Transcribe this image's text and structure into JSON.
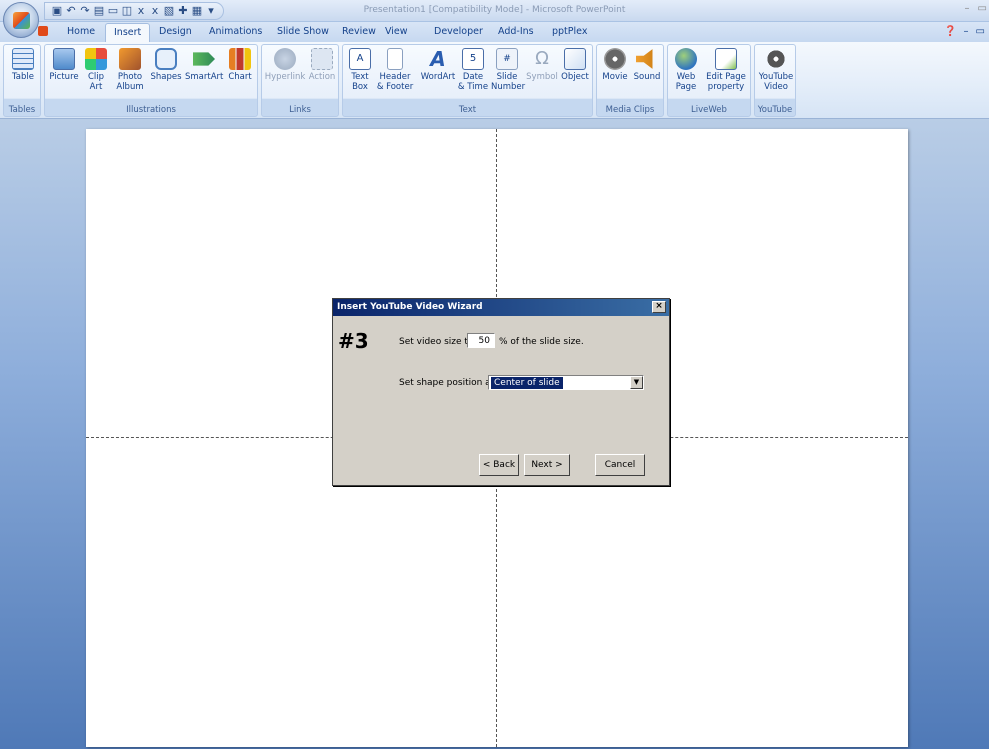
{
  "window": {
    "title": "Presentation1 [Compatibility Mode] - Microsoft PowerPoint"
  },
  "quick_access": {
    "icons": [
      "save-icon",
      "undo-icon",
      "redo-icon",
      "open-icon",
      "new-slide-icon",
      "insert-icon",
      "subscript-icon",
      "superscript-icon",
      "picture-icon",
      "clip-art-icon",
      "customize-icon"
    ]
  },
  "tabs": [
    "Home",
    "Insert",
    "Design",
    "Animations",
    "Slide Show",
    "Review",
    "View",
    "Developer",
    "Add-Ins",
    "pptPlex"
  ],
  "active_tab": "Insert",
  "ribbon": {
    "groups": {
      "tables": "Tables",
      "illustrations": "Illustrations",
      "links": "Links",
      "text": "Text",
      "media": "Media Clips",
      "liveweb": "LiveWeb",
      "youtube": "YouTube"
    },
    "buttons": {
      "table": "Table",
      "picture": "Picture",
      "clip_art": "Clip\nArt",
      "photo_album": "Photo\nAlbum",
      "shapes": "Shapes",
      "smartart": "SmartArt",
      "chart": "Chart",
      "hyperlink": "Hyperlink",
      "action": "Action",
      "text_box": "Text\nBox",
      "header_footer": "Header\n& Footer",
      "wordart": "WordArt",
      "date_time": "Date\n& Time",
      "slide_number": "Slide\nNumber",
      "symbol": "Symbol",
      "object": "Object",
      "movie": "Movie",
      "sound": "Sound",
      "web_page": "Web\nPage",
      "edit_page_property": "Edit Page\nproperty",
      "youtube_video": "YouTube\nVideo"
    }
  },
  "dialog": {
    "title": "Insert YouTube Video Wizard",
    "step": "#3",
    "size_prefix": "Set video size to",
    "size_value": "50",
    "size_suffix": "% of the slide size.",
    "position_label": "Set shape position at:",
    "position_value": "Center of slide",
    "back": "< Back",
    "next": "Next >",
    "cancel": "Cancel"
  }
}
